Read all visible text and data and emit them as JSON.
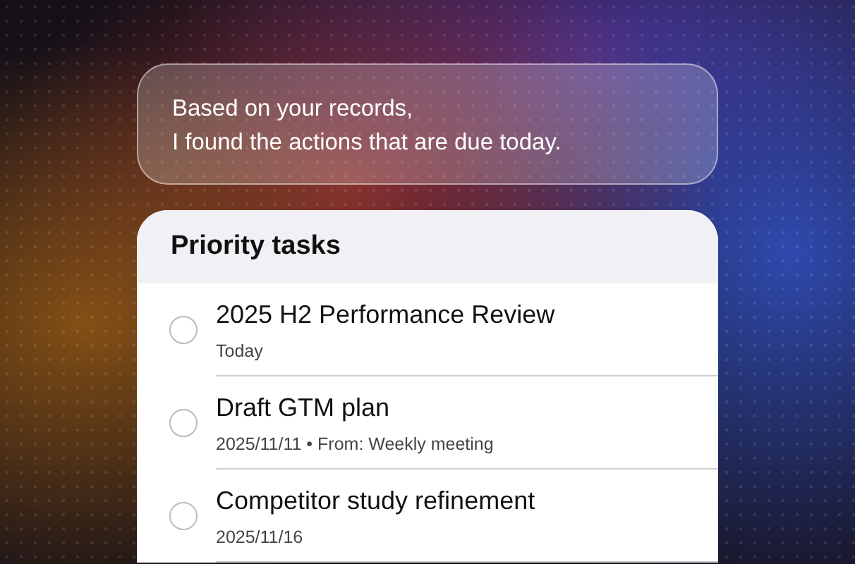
{
  "message": {
    "lines": [
      "Based on your records,",
      "I found the actions that are due today."
    ]
  },
  "tasks_card": {
    "title": "Priority tasks",
    "tasks": [
      {
        "title": "2025 H2 Performance Review",
        "meta": "Today",
        "checked": false
      },
      {
        "title": "Draft GTM plan",
        "meta": "2025/11/11 • From: Weekly meeting",
        "checked": false
      },
      {
        "title": "Competitor study refinement",
        "meta": "2025/11/16",
        "checked": false
      }
    ]
  }
}
